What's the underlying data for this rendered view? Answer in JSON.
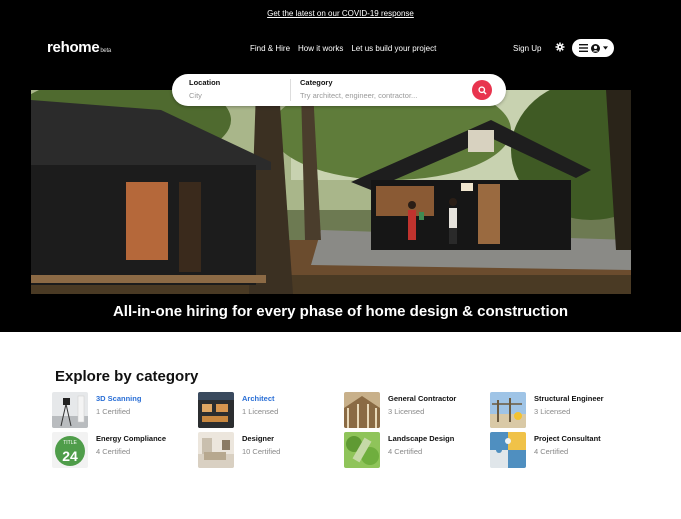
{
  "banner": {
    "covid_link": "Get the latest on our COVID-19 response"
  },
  "header": {
    "logo": "rehome",
    "logo_beta": "beta",
    "nav": [
      "Find & Hire",
      "How it works",
      "Let us build your project"
    ],
    "signup": "Sign Up",
    "icons": {
      "settings": "gear-icon",
      "menu": "hamburger-icon",
      "user": "user-icon",
      "caret": "chevron-down-icon"
    }
  },
  "search": {
    "location_label": "Location",
    "location_placeholder": "City",
    "category_label": "Category",
    "category_placeholder": "Try architect, engineer, contractor...",
    "accent": "#e8344e"
  },
  "hero": {
    "tagline": "All-in-one hiring for every phase of home design & construction"
  },
  "explore": {
    "title": "Explore by category",
    "categories": [
      {
        "name": "3D Scanning",
        "count": "1 Certified",
        "highlight": true
      },
      {
        "name": "Architect",
        "count": "1 Licensed",
        "highlight": true
      },
      {
        "name": "General Contractor",
        "count": "3 Licensed",
        "highlight": false
      },
      {
        "name": "Structural Engineer",
        "count": "3 Licensed",
        "highlight": false
      },
      {
        "name": "Energy Compliance",
        "count": "4 Certified",
        "highlight": false,
        "badge": "TITLE 24"
      },
      {
        "name": "Designer",
        "count": "10 Certified",
        "highlight": false
      },
      {
        "name": "Landscape Design",
        "count": "4 Certified",
        "highlight": false
      },
      {
        "name": "Project Consultant",
        "count": "4 Certified",
        "highlight": false
      }
    ]
  }
}
